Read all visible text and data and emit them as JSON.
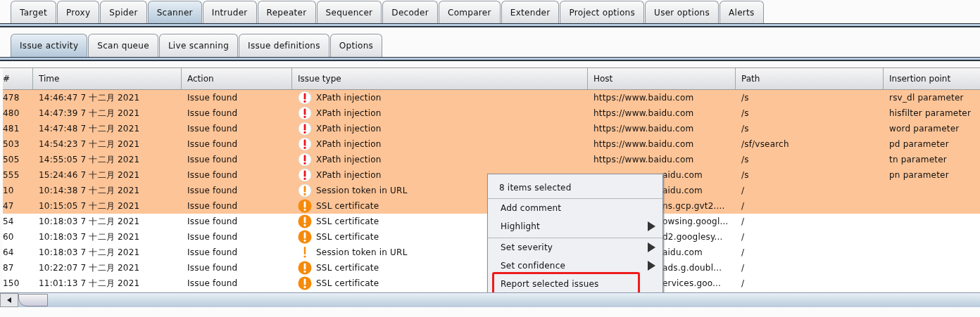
{
  "main_tabs": [
    {
      "label": "Target",
      "selected": false
    },
    {
      "label": "Proxy",
      "selected": false
    },
    {
      "label": "Spider",
      "selected": false
    },
    {
      "label": "Scanner",
      "selected": true
    },
    {
      "label": "Intruder",
      "selected": false
    },
    {
      "label": "Repeater",
      "selected": false
    },
    {
      "label": "Sequencer",
      "selected": false
    },
    {
      "label": "Decoder",
      "selected": false
    },
    {
      "label": "Comparer",
      "selected": false
    },
    {
      "label": "Extender",
      "selected": false
    },
    {
      "label": "Project options",
      "selected": false
    },
    {
      "label": "User options",
      "selected": false
    },
    {
      "label": "Alerts",
      "selected": false
    }
  ],
  "sub_tabs": [
    {
      "label": "Issue activity",
      "selected": true
    },
    {
      "label": "Scan queue",
      "selected": false
    },
    {
      "label": "Live scanning",
      "selected": false
    },
    {
      "label": "Issue definitions",
      "selected": false
    },
    {
      "label": "Options",
      "selected": false
    }
  ],
  "table": {
    "columns": [
      "#",
      "Time",
      "Action",
      "Issue type",
      "Host",
      "Path",
      "Insertion point"
    ],
    "rows": [
      {
        "num": "478",
        "time": "14:46:47 7 十二月 2021",
        "action": "Issue found",
        "kind": "high",
        "issue": "XPath injection",
        "host": "https://www.baidu.com",
        "path": "/s",
        "insertion": "rsv_dl parameter",
        "selected": true
      },
      {
        "num": "480",
        "time": "14:47:39 7 十二月 2021",
        "action": "Issue found",
        "kind": "high",
        "issue": "XPath injection",
        "host": "https://www.baidu.com",
        "path": "/s",
        "insertion": "hisfilter parameter",
        "selected": true
      },
      {
        "num": "481",
        "time": "14:47:48 7 十二月 2021",
        "action": "Issue found",
        "kind": "high",
        "issue": "XPath injection",
        "host": "https://www.baidu.com",
        "path": "/s",
        "insertion": "word parameter",
        "selected": true
      },
      {
        "num": "503",
        "time": "14:54:23 7 十二月 2021",
        "action": "Issue found",
        "kind": "high",
        "issue": "XPath injection",
        "host": "https://www.baidu.com",
        "path": "/sf/vsearch",
        "insertion": "pd parameter",
        "selected": true
      },
      {
        "num": "505",
        "time": "14:55:05 7 十二月 2021",
        "action": "Issue found",
        "kind": "high",
        "issue": "XPath injection",
        "host": "https://www.baidu.com",
        "path": "/s",
        "insertion": "tn parameter",
        "selected": true
      },
      {
        "num": "555",
        "time": "15:24:46 7 十二月 2021",
        "action": "Issue found",
        "kind": "high",
        "issue": "XPath injection",
        "host": "aidu.com",
        "path": "/s",
        "insertion": "pn parameter",
        "selected": true
      },
      {
        "num": "10",
        "time": "10:14:38 7 十二月 2021",
        "action": "Issue found",
        "kind": "low",
        "issue": "Session token in URL",
        "host": "aidu.com",
        "path": "/",
        "selected": true
      },
      {
        "num": "47",
        "time": "10:15:05 7 十二月 2021",
        "action": "Issue found",
        "kind": "medium",
        "issue": "SSL certificate",
        "host": "ns.gcp.gvt2....",
        "path": "/",
        "selected": true
      },
      {
        "num": "54",
        "time": "10:18:03 7 十二月 2021",
        "action": "Issue found",
        "kind": "medium",
        "issue": "SSL certificate",
        "host": "owsing.googl...",
        "path": "/",
        "selected": false
      },
      {
        "num": "60",
        "time": "10:18:03 7 十二月 2021",
        "action": "Issue found",
        "kind": "medium",
        "issue": "SSL certificate",
        "host": "d2.googlesy...",
        "path": "/",
        "selected": false
      },
      {
        "num": "64",
        "time": "10:18:03 7 十二月 2021",
        "action": "Issue found",
        "kind": "info",
        "issue": "Session token in URL",
        "host": "aidu.com",
        "path": "/",
        "selected": false
      },
      {
        "num": "87",
        "time": "10:22:07 7 十二月 2021",
        "action": "Issue found",
        "kind": "medium",
        "issue": "SSL certificate",
        "host": "ads.g.doubl...",
        "path": "/",
        "selected": false
      },
      {
        "num": "150",
        "time": "11:01:13 7 十二月 2021",
        "action": "Issue found",
        "kind": "medium",
        "issue": "SSL certificate",
        "host": "ervices.goo...",
        "path": "/",
        "selected": false
      }
    ]
  },
  "context_menu": {
    "header": "8 items selected",
    "items": [
      {
        "label": "Add comment",
        "submenu": false,
        "separator_before": false
      },
      {
        "label": "Highlight",
        "submenu": true,
        "separator_before": false
      },
      {
        "label": "Set severity",
        "submenu": true,
        "separator_before": true
      },
      {
        "label": "Set confidence",
        "submenu": true,
        "separator_before": false
      },
      {
        "label": "Report selected issues",
        "submenu": false,
        "separator_before": false,
        "marked": true
      }
    ]
  }
}
